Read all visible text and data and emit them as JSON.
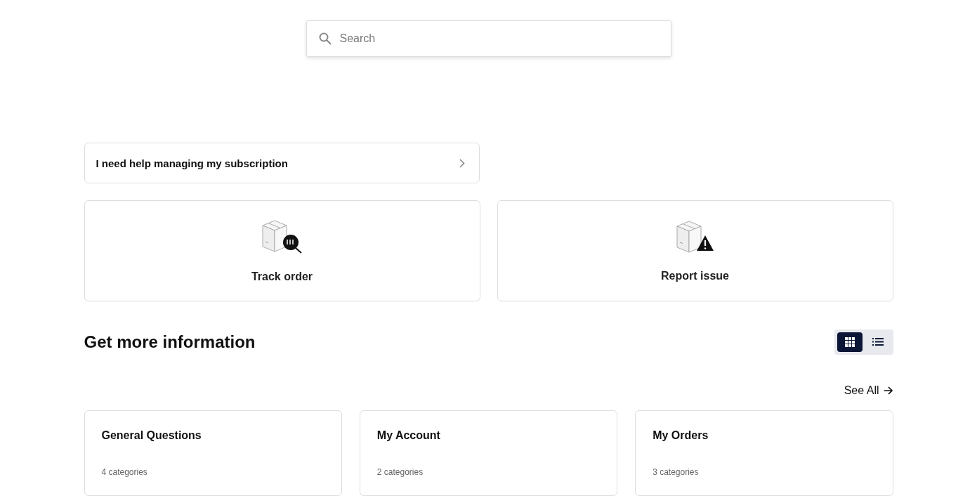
{
  "search": {
    "placeholder": "Search"
  },
  "help_link": {
    "label": "I need help managing my subscription"
  },
  "actions": [
    {
      "kind": "track",
      "label": "Track order"
    },
    {
      "kind": "report",
      "label": "Report issue"
    }
  ],
  "section": {
    "title": "Get more information",
    "view_modes": [
      {
        "kind": "grid",
        "selected": true
      },
      {
        "kind": "list",
        "selected": false
      }
    ],
    "see_all": "See All"
  },
  "categories": [
    {
      "title": "General Questions",
      "count": "4 categories"
    },
    {
      "title": "My Account",
      "count": "2 categories"
    },
    {
      "title": "My Orders",
      "count": "3 categories"
    }
  ]
}
